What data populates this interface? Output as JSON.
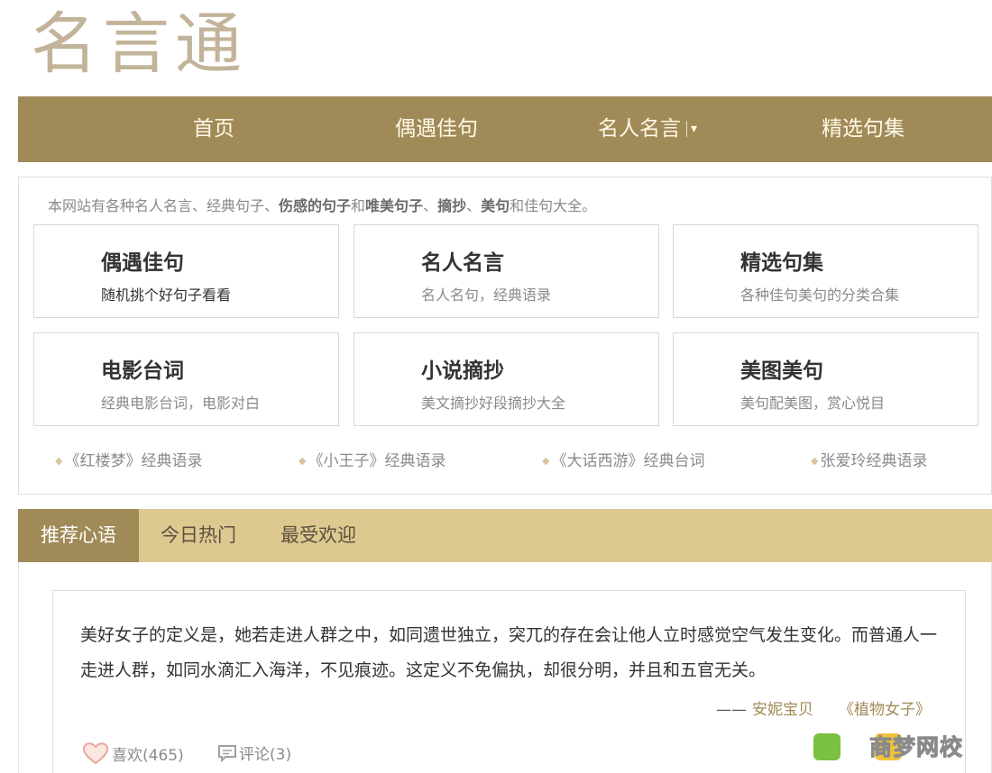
{
  "logo": "名言通",
  "nav": {
    "items": [
      {
        "label": "首页"
      },
      {
        "label": "偶遇佳句"
      },
      {
        "label": "名人名言",
        "caret": "▾"
      },
      {
        "label": "精选句集"
      }
    ]
  },
  "intro": {
    "parts": [
      "本网站有各种名人名言、经典句子、",
      "伤感的句子",
      "和",
      "唯美句子",
      "、",
      "摘抄",
      "、",
      "美句",
      "和佳句大全。"
    ]
  },
  "cards": [
    {
      "title": "偶遇佳句",
      "desc": "随机挑个好句子看看"
    },
    {
      "title": "名人名言",
      "desc": "名人名句，经典语录"
    },
    {
      "title": "精选句集",
      "desc": "各种佳句美句的分类合集"
    },
    {
      "title": "电影台词",
      "desc": "经典电影台词，电影对白"
    },
    {
      "title": "小说摘抄",
      "desc": "美文摘抄好段摘抄大全"
    },
    {
      "title": "美图美句",
      "desc": "美句配美图，赏心悦目"
    }
  ],
  "quick_links": [
    {
      "label": "《红楼梦》经典语录"
    },
    {
      "label": "《小王子》经典语录"
    },
    {
      "label": "《大话西游》经典台词"
    },
    {
      "label": "张爱玲经典语录"
    }
  ],
  "tabs": [
    {
      "label": "推荐心语",
      "active": true
    },
    {
      "label": "今日热门",
      "active": false
    },
    {
      "label": "最受欢迎",
      "active": false
    }
  ],
  "quote": {
    "text": "美好女子的定义是，她若走进人群之中，如同遗世独立，突兀的存在会让他人立时感觉空气发生变化。而普通人一走进人群，如同水滴汇入海洋，不见痕迹。这定义不免偏执，却很分明，并且和五官无关。",
    "dash": "——",
    "author": "安妮宝贝",
    "book": "《植物女子》",
    "like_label": "喜欢(465)",
    "comment_label": "评论(3)"
  },
  "watermark": {
    "text": "商梦网校"
  },
  "colors": {
    "nav_bg": "#a08a57",
    "tab_bar_bg": "#ddc990",
    "logo": "#c2b49a",
    "link_accent": "#a08a57"
  }
}
